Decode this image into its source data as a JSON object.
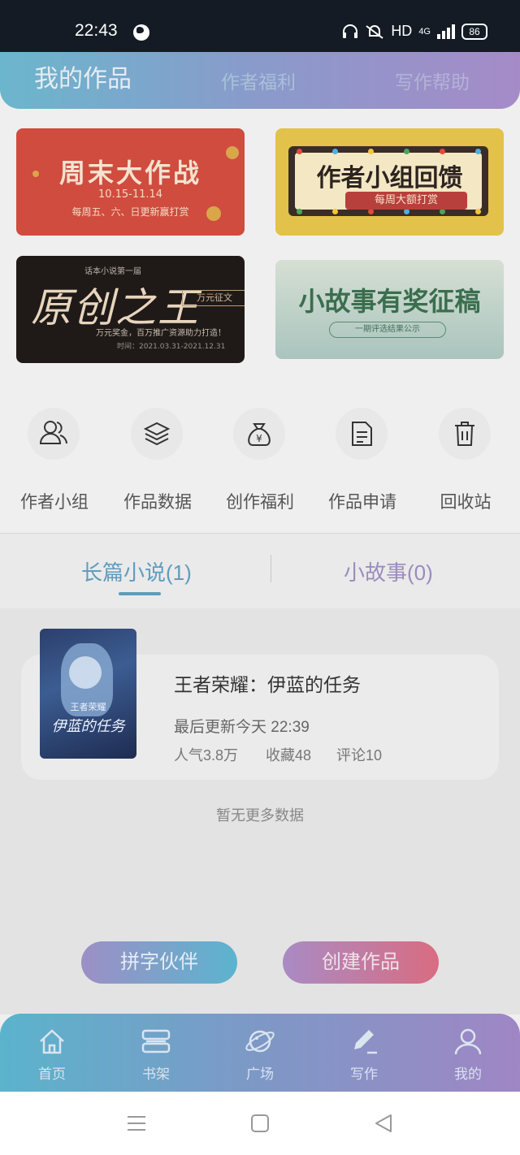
{
  "status_bar": {
    "time": "22:43",
    "hd": "HD",
    "network": "4G",
    "battery": "86"
  },
  "header": {
    "tabs": [
      "我的作品",
      "作者福利",
      "写作帮助"
    ]
  },
  "banners": {
    "b1": {
      "title": "周末大作战",
      "date": "10.15-11.14",
      "sub": "每周五、六、日更新赢打赏"
    },
    "b2": {
      "title": "作者小组回馈",
      "ribbon": "每周大额打赏"
    },
    "b3": {
      "top": "话本小说第一届",
      "title": "原创之王",
      "tag": "万元征文",
      "sub": "万元奖金，百万推广资源助力打造！",
      "date": "时间：2021.03.31-2021.12.31"
    },
    "b4": {
      "title": "小故事有奖征稿",
      "pill": "一期评选结果公示"
    }
  },
  "quick_menu": [
    {
      "label": "作者小组",
      "icon": "users-icon"
    },
    {
      "label": "作品数据",
      "icon": "layers-icon"
    },
    {
      "label": "创作福利",
      "icon": "money-bag-icon"
    },
    {
      "label": "作品申请",
      "icon": "document-icon"
    },
    {
      "label": "回收站",
      "icon": "trash-icon"
    }
  ],
  "content_tabs": {
    "long": "长篇小说(1)",
    "short": "小故事(0)"
  },
  "book": {
    "title": "王者荣耀：伊蓝的任务",
    "update": "最后更新今天 22:39",
    "popularity": "人气3.8万",
    "favorites": "收藏48",
    "comments": "评论10",
    "cover_text": "伊蓝的任务",
    "cover_small": "王者荣耀"
  },
  "no_more": "暂无更多数据",
  "actions": {
    "partner": "拼字伙伴",
    "create": "创建作品"
  },
  "bottom_nav": [
    {
      "label": "首页",
      "icon": "home-icon"
    },
    {
      "label": "书架",
      "icon": "bookshelf-icon"
    },
    {
      "label": "广场",
      "icon": "planet-icon"
    },
    {
      "label": "写作",
      "icon": "pen-icon"
    },
    {
      "label": "我的",
      "icon": "profile-icon"
    }
  ],
  "colors": {
    "accent_blue": "#5f9cbc",
    "accent_purple": "#9a8cbe",
    "accent_pink": "#d96c81"
  }
}
